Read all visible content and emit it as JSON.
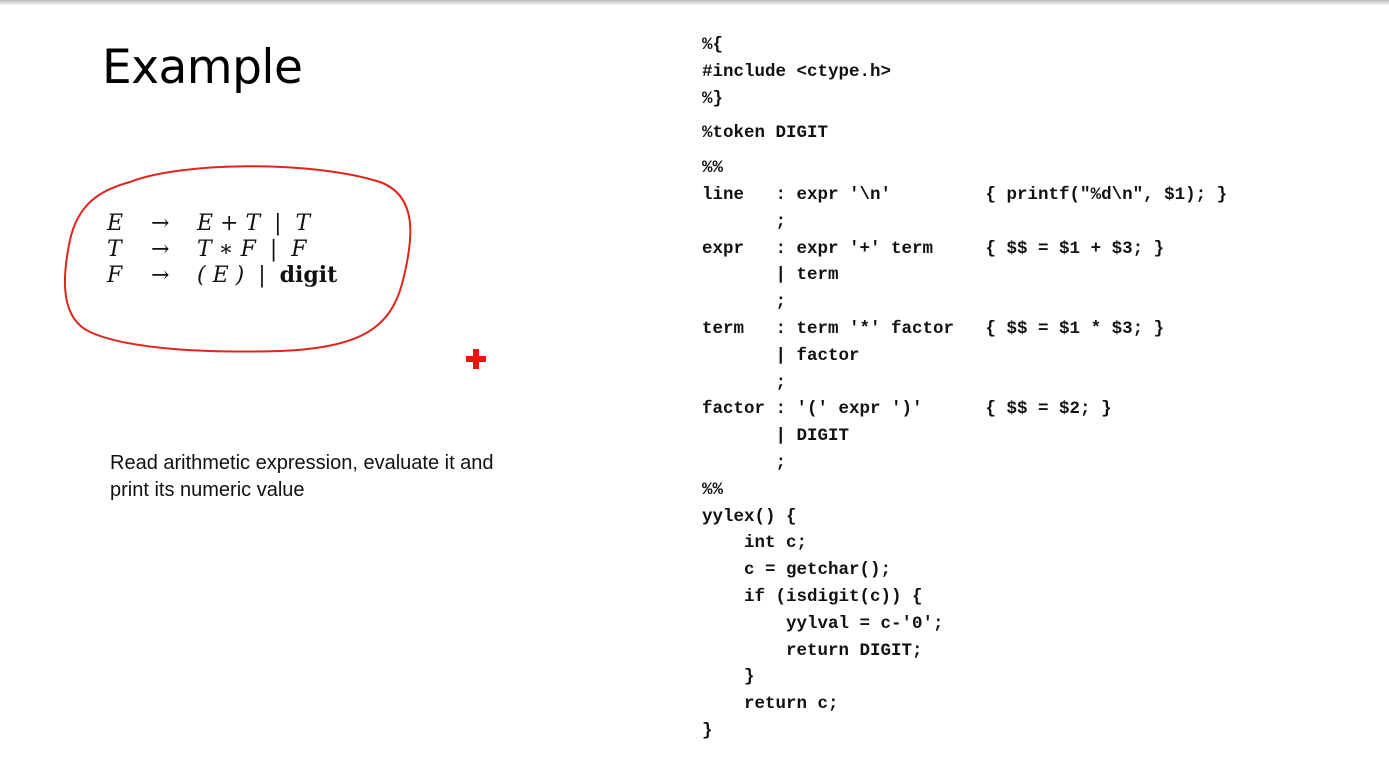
{
  "slide": {
    "title": "Example",
    "description_line1": "Read arithmetic expression, evaluate it and",
    "description_line2": "print its numeric value"
  },
  "grammar": [
    {
      "lhs": "E",
      "arrow": "→",
      "rhs": "E + T  |  T",
      "bold_tail": ""
    },
    {
      "lhs": "T",
      "arrow": "→",
      "rhs": "T ∗ F  |  F",
      "bold_tail": ""
    },
    {
      "lhs": "F",
      "arrow": "→",
      "rhs": "( E )  |  ",
      "bold_tail": "digit"
    }
  ],
  "annotation": {
    "circle_color": "#e1251b",
    "cursor_color": "#e8150b"
  },
  "code_lines": [
    "%{",
    "#include <ctype.h>",
    "%}",
    "",
    "%token DIGIT",
    "",
    "%%",
    "line   : expr '\\n'         { printf(\"%d\\n\", $1); }",
    "       ;",
    "expr   : expr '+' term     { $$ = $1 + $3; }",
    "       | term",
    "       ;",
    "term   : term '*' factor   { $$ = $1 * $3; }",
    "       | factor",
    "       ;",
    "factor : '(' expr ')'      { $$ = $2; }",
    "       | DIGIT",
    "       ;",
    "%%",
    "yylex() {",
    "    int c;",
    "    c = getchar();",
    "    if (isdigit(c)) {",
    "        yylval = c-'0';",
    "        return DIGIT;",
    "    }",
    "    return c;",
    "}"
  ]
}
